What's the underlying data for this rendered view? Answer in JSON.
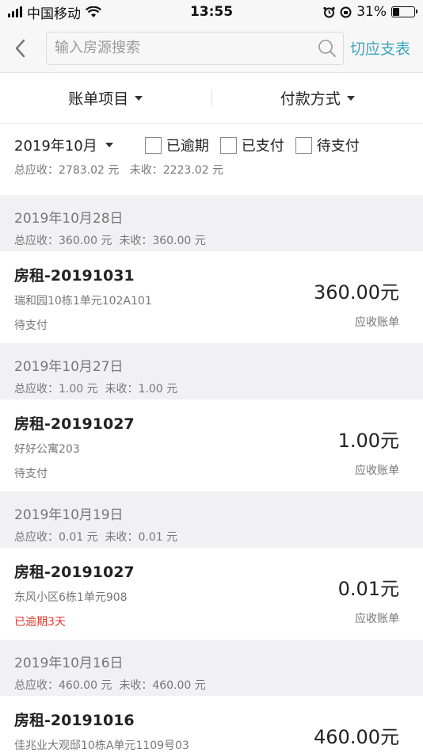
{
  "status_bar": {
    "carrier": "中国移动",
    "time": "13:55",
    "battery": "31%",
    "battery_level": 0.31
  },
  "search": {
    "placeholder": "输入房源搜索",
    "switch_label": "切应支表"
  },
  "filters": {
    "bill_item": "账单项目",
    "payment_method": "付款方式"
  },
  "summary": {
    "month": "2019年10月",
    "overdue_label": "已逾期",
    "paid_label": "已支付",
    "pending_label": "待支付",
    "totals": "总应收：2783.02 元   未收：2223.02 元"
  },
  "groups": [
    {
      "date": "2019年10月28日",
      "totals": "总应收：360.00 元  未收：360.00 元",
      "bill": {
        "title": "房租-20191031",
        "address": "瑞和园10栋1单元102A101",
        "status": "待支付",
        "amount": "360.00元",
        "type": "应收账单"
      }
    },
    {
      "date": "2019年10月27日",
      "totals": "总应收：1.00 元  未收：1.00 元",
      "bill": {
        "title": "房租-20191027",
        "address": "好好公寓203",
        "status": "待支付",
        "amount": "1.00元",
        "type": "应收账单"
      }
    },
    {
      "date": "2019年10月19日",
      "totals": "总应收：0.01 元  未收：0.01 元",
      "bill": {
        "title": "房租-20191027",
        "address": "东风小区6栋1单元908",
        "status": "已逾期3天",
        "amount": "0.01元",
        "type": "应收账单"
      }
    },
    {
      "date": "2019年10月16日",
      "totals": "总应收：460.00 元  未收：460.00 元",
      "bill": {
        "title": "房租-20191016",
        "address": "佳兆业大观邸10栋A单元1109号03",
        "status": "",
        "amount": "460.00元",
        "type": ""
      }
    }
  ],
  "colors": {
    "accent": "#3aa6bd",
    "overdue": "#e03a2f",
    "background": "#f1f1f4"
  }
}
